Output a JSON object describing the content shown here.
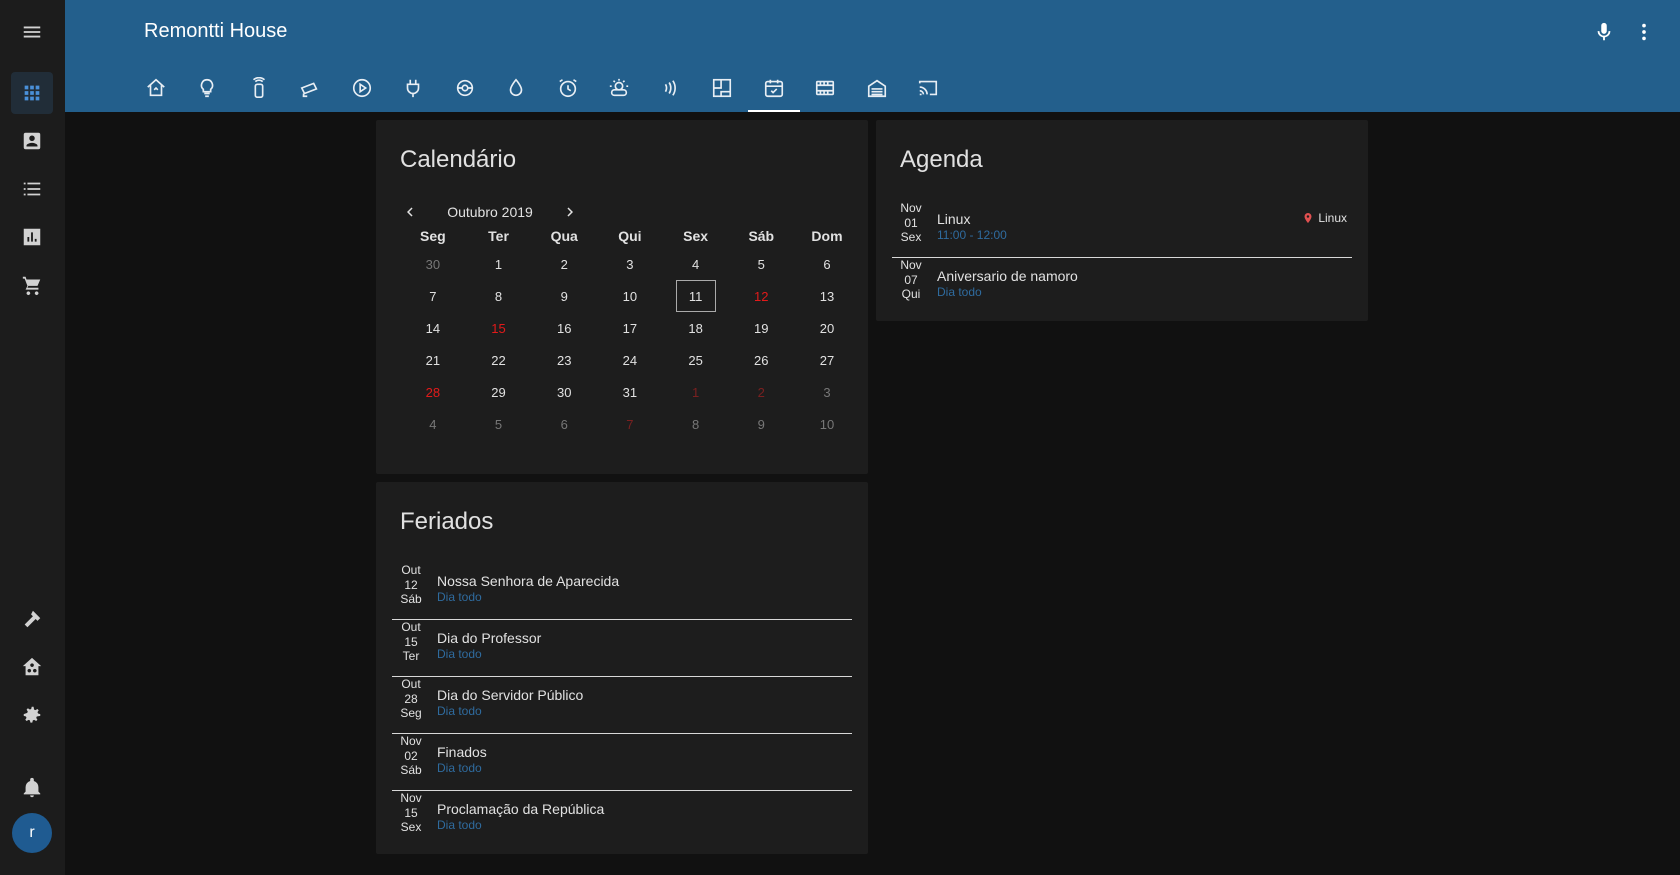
{
  "app": {
    "title": "Remontti House",
    "avatar_initial": "r"
  },
  "sidebar": {
    "items": [
      {
        "icon": "hamburger-menu-icon"
      },
      {
        "icon": "dashboard-grid-icon"
      },
      {
        "icon": "account-box-icon"
      },
      {
        "icon": "logbook-list-icon"
      },
      {
        "icon": "history-chart-icon"
      },
      {
        "icon": "shopping-cart-icon"
      },
      {
        "icon": "hammer-icon"
      },
      {
        "icon": "home-assistant-icon"
      },
      {
        "icon": "gear-icon"
      },
      {
        "icon": "bell-icon"
      }
    ]
  },
  "header": {
    "tabs": [
      "home-automation-icon",
      "lightbulb-icon",
      "remote-icon",
      "cctv-icon",
      "play-circle-icon",
      "power-plug-icon",
      "vacuum-robot-icon",
      "water-drop-icon",
      "alarm-clock-icon",
      "weather-icon",
      "wifi-signal-icon",
      "floor-plan-icon",
      "calendar-icon",
      "film-icon",
      "garage-icon",
      "cast-icon"
    ],
    "active_tab": 12
  },
  "calendar": {
    "title": "Calendário",
    "month_label": "Outubro 2019",
    "weekdays": [
      "Seg",
      "Ter",
      "Qua",
      "Qui",
      "Sex",
      "Sáb",
      "Dom"
    ],
    "weeks": [
      [
        {
          "d": "30",
          "o": 1
        },
        {
          "d": "1"
        },
        {
          "d": "2"
        },
        {
          "d": "3"
        },
        {
          "d": "4"
        },
        {
          "d": "5"
        },
        {
          "d": "6"
        }
      ],
      [
        {
          "d": "7"
        },
        {
          "d": "8"
        },
        {
          "d": "9"
        },
        {
          "d": "10"
        },
        {
          "d": "11",
          "t": 1
        },
        {
          "d": "12",
          "h": 1
        },
        {
          "d": "13"
        }
      ],
      [
        {
          "d": "14"
        },
        {
          "d": "15",
          "h": 1
        },
        {
          "d": "16"
        },
        {
          "d": "17"
        },
        {
          "d": "18"
        },
        {
          "d": "19"
        },
        {
          "d": "20"
        }
      ],
      [
        {
          "d": "21"
        },
        {
          "d": "22"
        },
        {
          "d": "23"
        },
        {
          "d": "24"
        },
        {
          "d": "25"
        },
        {
          "d": "26"
        },
        {
          "d": "27"
        }
      ],
      [
        {
          "d": "28",
          "h": 1
        },
        {
          "d": "29"
        },
        {
          "d": "30"
        },
        {
          "d": "31"
        },
        {
          "d": "1",
          "o": 1,
          "h": 1
        },
        {
          "d": "2",
          "o": 1,
          "h": 1
        },
        {
          "d": "3",
          "o": 1
        }
      ],
      [
        {
          "d": "4",
          "o": 1
        },
        {
          "d": "5",
          "o": 1
        },
        {
          "d": "6",
          "o": 1
        },
        {
          "d": "7",
          "o": 1,
          "h": 1
        },
        {
          "d": "8",
          "o": 1
        },
        {
          "d": "9",
          "o": 1
        },
        {
          "d": "10",
          "o": 1
        }
      ]
    ],
    "holiday_color": "#e21a1a"
  },
  "holidays": {
    "title": "Feriados",
    "events": [
      {
        "month": "Out",
        "day": "12",
        "weekday": "Sáb",
        "title": "Nossa Senhora de Aparecida",
        "time": "Dia todo"
      },
      {
        "month": "Out",
        "day": "15",
        "weekday": "Ter",
        "title": "Dia do Professor",
        "time": "Dia todo"
      },
      {
        "month": "Out",
        "day": "28",
        "weekday": "Seg",
        "title": "Dia do Servidor Público",
        "time": "Dia todo"
      },
      {
        "month": "Nov",
        "day": "02",
        "weekday": "Sáb",
        "title": "Finados",
        "time": "Dia todo"
      },
      {
        "month": "Nov",
        "day": "15",
        "weekday": "Sex",
        "title": "Proclamação da República",
        "time": "Dia todo"
      }
    ]
  },
  "agenda": {
    "title": "Agenda",
    "events": [
      {
        "month": "Nov",
        "day": "01",
        "weekday": "Sex",
        "title": "Linux",
        "time": "11:00 - 12:00",
        "location": "Linux"
      },
      {
        "month": "Nov",
        "day": "07",
        "weekday": "Qui",
        "title": "Aniversario de namoro",
        "time": "Dia todo"
      }
    ]
  },
  "colors": {
    "header": "#235f8c",
    "accent_text": "#2f6b9e",
    "background": "#111111",
    "card": "#1d1d1d"
  }
}
